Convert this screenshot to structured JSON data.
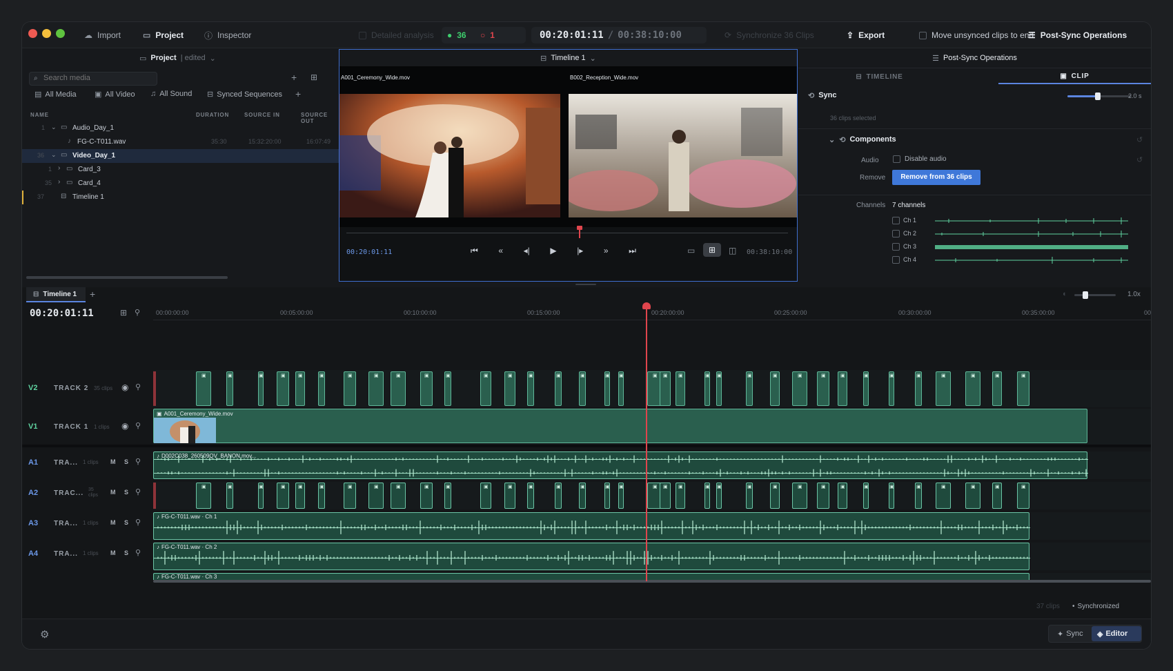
{
  "toolbar": {
    "import": "Import",
    "project": "Project",
    "inspector": "Inspector",
    "detailed_analysis": "Detailed analysis",
    "synced_count": "36",
    "error_count": "1",
    "timecode_current": "00:20:01:11",
    "timecode_sep": "/",
    "timecode_total": "00:38:10:00",
    "synchronize": "Synchronize 36 Clips",
    "export": "Export",
    "move_unsynced": "Move unsynced clips to end",
    "post_sync": "Post-Sync Operations"
  },
  "project_panel": {
    "title": "Project",
    "status": "| edited",
    "search_placeholder": "Search media",
    "filters": [
      "All Media",
      "All Video",
      "All Sound",
      "Synced Sequences"
    ],
    "columns": {
      "name": "NAME",
      "duration": "DURATION",
      "source_in": "SOURCE IN",
      "source_out": "SOURCE OUT"
    },
    "rows": [
      {
        "num": "1",
        "name": "Audio_Day_1",
        "duration": "",
        "in": "",
        "out": ""
      },
      {
        "num": "",
        "name": "FG-C-T011.wav",
        "duration": "35:30",
        "in": "15:32:20:00",
        "out": "16:07:49"
      },
      {
        "num": "36",
        "name": "Video_Day_1",
        "duration": "",
        "in": "",
        "out": ""
      },
      {
        "num": "1",
        "name": "Card_3",
        "duration": "",
        "in": "",
        "out": ""
      },
      {
        "num": "35",
        "name": "Card_4",
        "duration": "",
        "in": "",
        "out": ""
      },
      {
        "num": "37",
        "name": "Timeline 1",
        "duration": "",
        "in": "",
        "out": ""
      }
    ]
  },
  "viewer": {
    "title": "Timeline 1",
    "left_clip": "A001_Ceremony_Wide.mov",
    "right_clip": "B002_Reception_Wide.mov",
    "timecode": "00:20:01:11",
    "duration": "00:38:10:00"
  },
  "inspector": {
    "header": "Post-Sync Operations",
    "tab_timeline": "TIMELINE",
    "tab_clip": "CLIP",
    "sync_label": "Sync",
    "sync_value": "2.0 s",
    "sync_level": 0.47,
    "selection": "36 clips selected",
    "components": "Components",
    "audio_label": "Audio",
    "disable_audio": "Disable audio",
    "remove_label": "Remove",
    "remove_button": "Remove from 36 clips",
    "channels_label": "Channels",
    "channels_value": "7 channels",
    "channels": [
      "Ch 1",
      "Ch 2",
      "Ch 3",
      "Ch 4"
    ]
  },
  "timeline": {
    "tab": "Timeline 1",
    "timecode": "00:20:01:11",
    "zoom": "1.0x",
    "ruler": [
      "00:00:00:00",
      "00:05:00:00",
      "00:10:00:00",
      "00:15:00:00",
      "00:20:00:00",
      "00:25:00:00",
      "00:30:00:00",
      "00:35:00:00",
      "00"
    ],
    "tracks": [
      {
        "id": "V2",
        "name": "TRACK 2",
        "clips": "35 clips"
      },
      {
        "id": "V1",
        "name": "TRACK 1",
        "clips": "1 clips"
      },
      {
        "id": "A1",
        "name": "TRA...",
        "clips": "1 clips"
      },
      {
        "id": "A2",
        "name": "TRAC...",
        "clips": "35 clips"
      },
      {
        "id": "A3",
        "name": "TRA...",
        "clips": "1 clips"
      },
      {
        "id": "A4",
        "name": "TRA...",
        "clips": "1 clips"
      }
    ],
    "v1_clip": "A001_Ceremony_Wide.mov",
    "a1_clip": "D002C038_260509QV_BANON.mov...",
    "a3_clip": "FG-C-T011.wav · Ch 1",
    "a4_clip": "FG-C-T011.wav · Ch 2",
    "a5_clip": "FG-C-T011.wav · Ch 3",
    "mute": "M",
    "solo": "S"
  },
  "status": {
    "clips": "37 clips",
    "synchronized": "Synchronized",
    "sync_btn": "Sync",
    "editor_btn": "Editor"
  },
  "colors": {
    "accent": "#3f6fcf",
    "clip": "#2a5f4e",
    "playhead": "#e0454d",
    "ok": "#3ecf6e",
    "error": "#e0454d"
  }
}
